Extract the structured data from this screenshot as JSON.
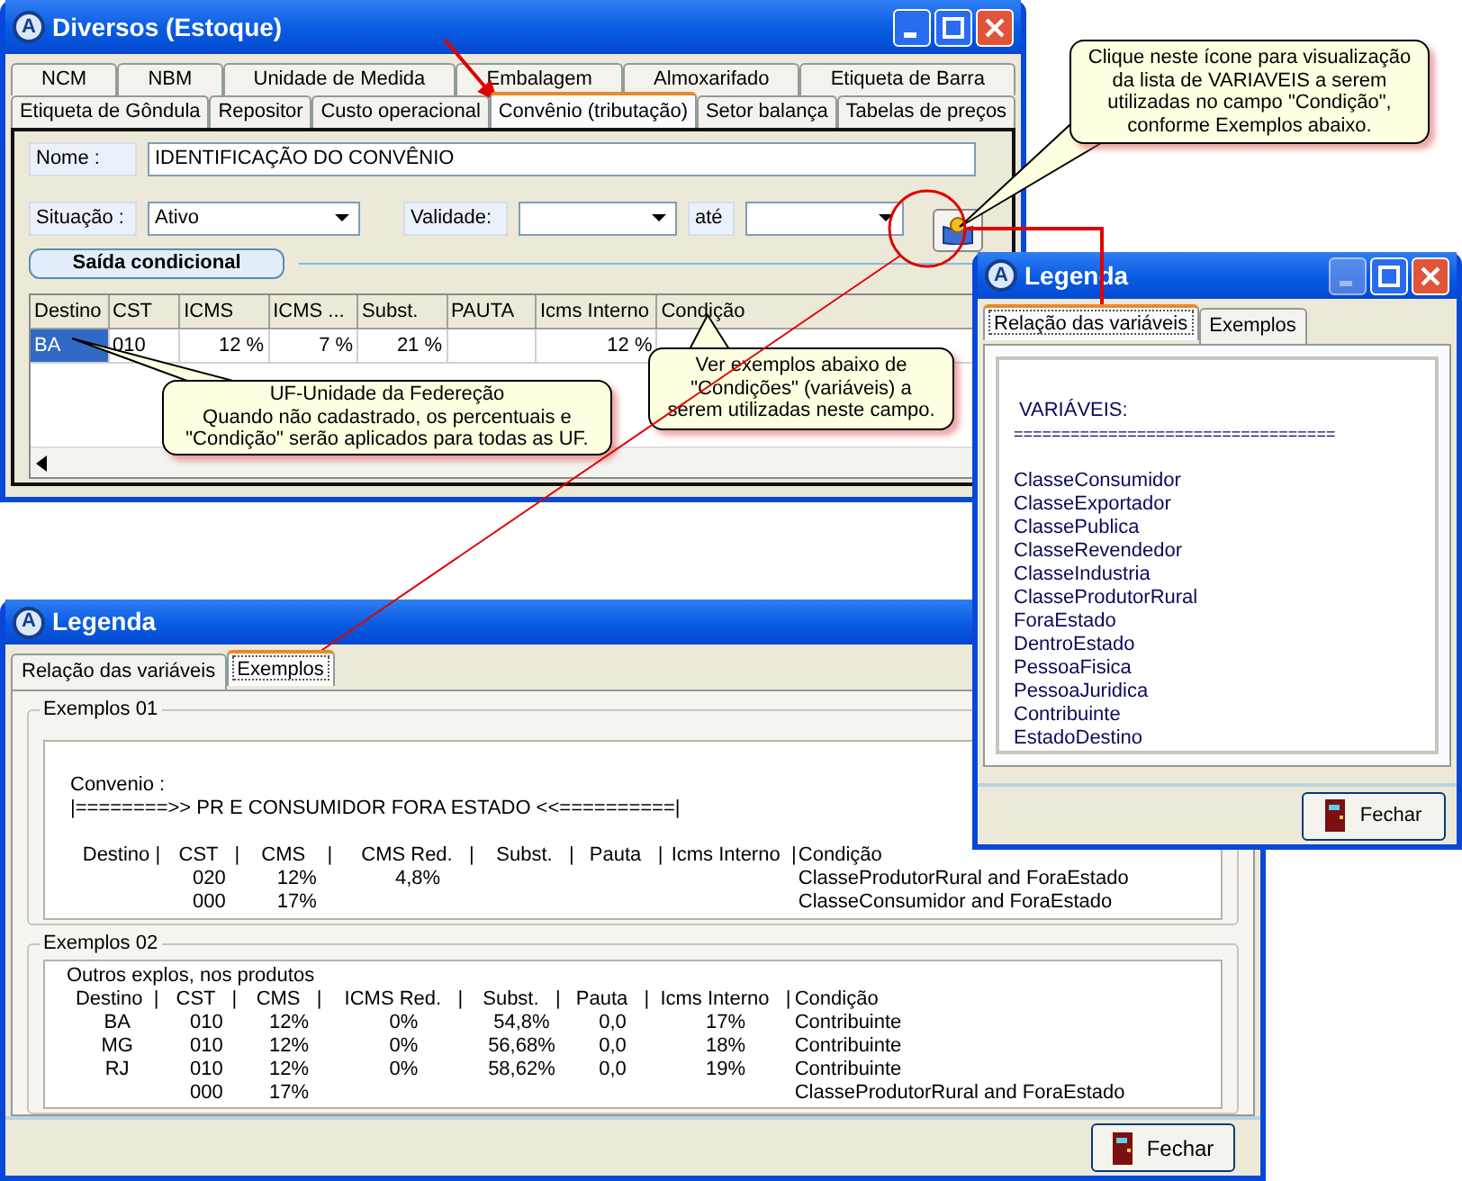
{
  "main_window": {
    "icon_letter": "A",
    "title": "Diversos (Estoque)",
    "controls": [
      {
        "kind": "minimize",
        "disabled": false
      },
      {
        "kind": "maximize",
        "disabled": false
      },
      {
        "kind": "close",
        "disabled": false
      }
    ],
    "tab_rows": [
      [
        {
          "label": "NCM",
          "selected": false
        },
        {
          "label": "NBM",
          "selected": false
        },
        {
          "label": "Unidade de Medida",
          "selected": false
        },
        {
          "label": "Embalagem",
          "selected": false
        },
        {
          "label": "Almoxarifado",
          "selected": false
        },
        {
          "label": "Etiqueta de Barra",
          "selected": false
        }
      ],
      [
        {
          "label": "Etiqueta de Gôndula",
          "selected": false
        },
        {
          "label": "Repositor",
          "selected": false
        },
        {
          "label": "Custo operacional",
          "selected": false
        },
        {
          "label": "Convênio (tributação)",
          "selected": true
        },
        {
          "label": "Setor balança",
          "selected": false
        },
        {
          "label": "Tabelas de preços",
          "selected": false
        }
      ]
    ],
    "name_field": {
      "label": "Nome :",
      "value": "IDENTIFICAÇÃO DO CONVÊNIO"
    },
    "status_field": {
      "label": "Situação :",
      "value": "Ativo"
    },
    "validity": {
      "label": "Validade:",
      "to_label": "até"
    },
    "section_title": "Saída condicional",
    "grid": {
      "columns": [
        {
          "label": "Destino",
          "kind": "text"
        },
        {
          "label": "CST",
          "kind": "text"
        },
        {
          "label": "ICMS",
          "kind": "number"
        },
        {
          "label": "ICMS ...",
          "kind": "number"
        },
        {
          "label": "Subst.",
          "kind": "number"
        },
        {
          "label": "PAUTA",
          "kind": "number"
        },
        {
          "label": "Icms Interno",
          "kind": "number"
        },
        {
          "label": "Condição",
          "kind": "text"
        }
      ],
      "rows": [
        {
          "selected": true,
          "cells": [
            "BA",
            "010",
            "12 %",
            "7 %",
            "21 %",
            null,
            "12 %",
            null
          ]
        }
      ]
    }
  },
  "legend_window": {
    "icon_letter": "A",
    "title": "Legenda",
    "controls": [
      {
        "kind": "minimize",
        "disabled": true
      },
      {
        "kind": "maximize",
        "disabled": false
      },
      {
        "kind": "close",
        "disabled": false
      }
    ],
    "tabs": [
      {
        "label": "Relação das variáveis",
        "selected": true
      },
      {
        "label": "Exemplos",
        "selected": false
      }
    ],
    "heading": "VARIÁVEIS:",
    "rule": "==================================",
    "variables": [
      "ClasseConsumidor",
      "ClasseExportador",
      "ClassePublica",
      "ClasseRevendedor",
      "ClasseIndustria",
      "ClasseProdutorRural",
      "ForaEstado",
      "DentroEstado",
      "PessoaFisica",
      "PessoaJuridica",
      "Contribuinte",
      "EstadoDestino"
    ],
    "close_button": "Fechar"
  },
  "examples_window": {
    "icon_letter": "A",
    "title": "Legenda",
    "tabs": [
      {
        "label": "Relação das variáveis",
        "selected": false
      },
      {
        "label": "Exemplos",
        "selected": true
      }
    ],
    "groups": [
      {
        "title": "Exemplos 01",
        "intro_lines": [
          "Convenio :",
          "|========>> PR E CONSUMIDOR FORA ESTADO <<==========|"
        ],
        "columns": [
          "Destino |",
          "CST   |",
          "CMS    |",
          "CMS Red.   |",
          "Subst.   |",
          "Pauta   |",
          "Icms Interno  |",
          "Condição"
        ],
        "rows": [
          [
            null,
            "020",
            "12%",
            "4,8%",
            null,
            null,
            null,
            "ClasseProdutorRural and ForaEstado"
          ],
          [
            null,
            "000",
            "17%",
            null,
            null,
            null,
            null,
            "ClasseConsumidor and ForaEstado"
          ]
        ]
      },
      {
        "title": "Exemplos 02",
        "intro_lines": [
          "Outros explos, nos produtos"
        ],
        "columns": [
          "Destino  |",
          "CST   |",
          "CMS   |",
          "ICMS Red.   |",
          "Subst.   |",
          "Pauta   |",
          "Icms Interno   |",
          "Condição"
        ],
        "rows": [
          [
            "BA",
            "010",
            "12%",
            "0%",
            "54,8%",
            "0,0",
            "17%",
            "Contribuinte"
          ],
          [
            "MG",
            "010",
            "12%",
            "0%",
            "56,68%",
            "0,0",
            "18%",
            "Contribuinte"
          ],
          [
            "RJ",
            "010",
            "12%",
            "0%",
            "58,62%",
            "0,0",
            "19%",
            "Contribuinte"
          ],
          [
            null,
            "000",
            "17%",
            null,
            null,
            null,
            null,
            "ClasseProdutorRural and ForaEstado"
          ]
        ]
      }
    ],
    "close_button": "Fechar"
  },
  "callouts": [
    {
      "text": "Clique neste ícone para visualização\nda lista de VARIAVEIS a serem\nutilizadas no campo \"Condição\",\nconforme Exemplos abaixo."
    },
    {
      "text": "UF-Unidade da Federeção\nQuando não cadastrado, os percentuais e\n\"Condição\" serão aplicados para todas as UF."
    },
    {
      "text": "Ver exemplos abaixo de\n\"Condições\" (variáveis) a\nserem utilizadas neste campo."
    }
  ]
}
